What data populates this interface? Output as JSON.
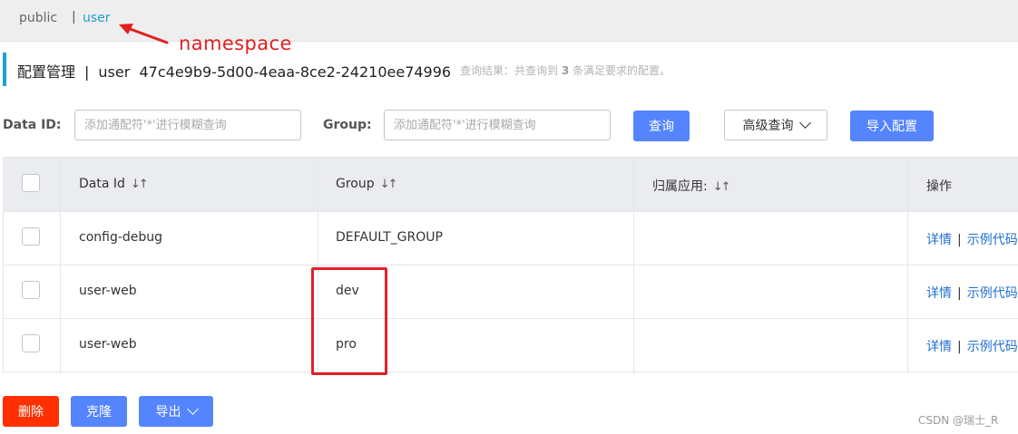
{
  "namespace_bar": {
    "public_label": "public",
    "separator": "|",
    "active_label": "user"
  },
  "annotation": {
    "label": "namespace",
    "color": "#e02020"
  },
  "header": {
    "title_prefix": "配置管理",
    "title_sep": "|",
    "namespace_name": "user",
    "namespace_id": "47c4e9b9-5d00-4eaa-8ce2-24210ee74996",
    "result_prefix": "查询结果：共查询到",
    "result_count": "3",
    "result_suffix": "条满足要求的配置。"
  },
  "search": {
    "data_id_label": "Data ID:",
    "data_id_placeholder": "添加通配符'*'进行模糊查询",
    "group_label": "Group:",
    "group_placeholder": "添加通配符'*'进行模糊查询",
    "query_button": "查询",
    "advanced_button": "高级查询",
    "import_button": "导入配置"
  },
  "table": {
    "columns": [
      "Data Id",
      "Group",
      "归属应用:",
      "操作"
    ],
    "sort_icon": "sort-icon",
    "rows": [
      {
        "data_id": "config-debug",
        "group": "DEFAULT_GROUP",
        "app": "",
        "op_detail": "详情",
        "op_sample": "示例代码"
      },
      {
        "data_id": "user-web",
        "group": "dev",
        "app": "",
        "op_detail": "详情",
        "op_sample": "示例代码"
      },
      {
        "data_id": "user-web",
        "group": "pro",
        "app": "",
        "op_detail": "详情",
        "op_sample": "示例代码"
      }
    ],
    "op_separator": "|"
  },
  "footer": {
    "delete_button": "删除",
    "clone_button": "克隆",
    "export_button": "导出"
  },
  "watermark": "CSDN @瑞士_R",
  "colors": {
    "primary": "#5584ff",
    "danger": "#ff3000",
    "link": "#1f6fd0",
    "namespace_active": "#1fa0d2",
    "highlight": "#e0202a"
  }
}
